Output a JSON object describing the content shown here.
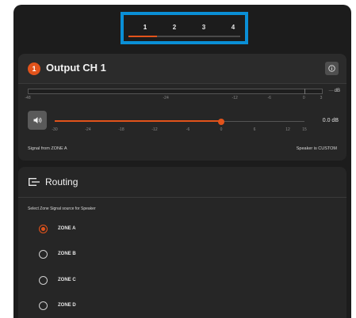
{
  "tabs": {
    "items": [
      "1",
      "2",
      "3",
      "4"
    ],
    "selected": "1"
  },
  "output": {
    "badge": "1",
    "title": "Output CH 1",
    "info_icon": "info-icon",
    "meter": {
      "unit": "dB",
      "scale": [
        "-48",
        "-24",
        "-12",
        "-6",
        "0",
        "3"
      ],
      "level": 0
    },
    "mute_icon": "speaker-icon",
    "gain": {
      "value_label": "0.0 dB",
      "value": 0,
      "min": -30,
      "max": 15,
      "scale": [
        "-30",
        "-24",
        "-18",
        "-12",
        "-6",
        "0",
        "6",
        "12",
        "15"
      ]
    },
    "signal_from": "Signal from ZONE A",
    "speaker_type": "Speaker is CUSTOM"
  },
  "routing": {
    "icon": "routing-icon",
    "title": "Routing",
    "description": "Select Zone Signal source for Speaker",
    "zones": [
      "ZONE A",
      "ZONE B",
      "ZONE C",
      "ZONE D"
    ],
    "selected": "ZONE A"
  },
  "colors": {
    "accent": "#e2531b",
    "highlight": "#0a8fd6",
    "background": "#1c1c1c",
    "card": "#262626"
  }
}
